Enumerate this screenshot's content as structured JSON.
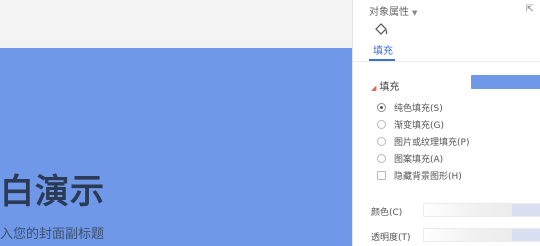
{
  "slide": {
    "title": "白演示",
    "subtitle": "入您的封面副标题",
    "background_color": "#6f99e8"
  },
  "panel": {
    "header": "对象属性",
    "pin_icon": "pin-icon",
    "tab_icon": "fill-bucket-icon",
    "active_tab": "填充",
    "fill_section": {
      "title": "填充",
      "swatch_color": "#6f99e8",
      "options": [
        {
          "label": "纯色填充(S)",
          "type": "radio",
          "selected": true
        },
        {
          "label": "渐变填充(G)",
          "type": "radio",
          "selected": false
        },
        {
          "label": "图片或纹理填充(P)",
          "type": "radio",
          "selected": false
        },
        {
          "label": "图案填充(A)",
          "type": "radio",
          "selected": false
        },
        {
          "label": "隐藏背景图形(H)",
          "type": "checkbox",
          "selected": false
        }
      ],
      "color_label": "颜色(C)",
      "transparency_label": "透明度(T)"
    }
  },
  "accent_color": "#3a6fd8"
}
